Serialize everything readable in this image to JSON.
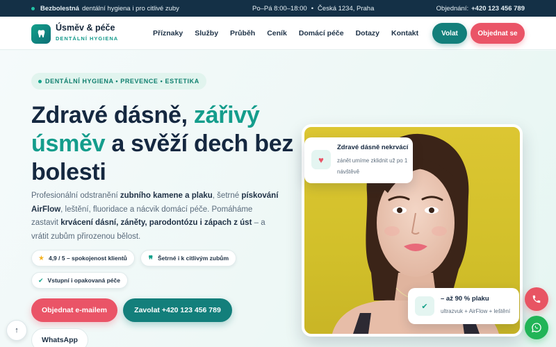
{
  "topbar": {
    "brand": "Bezbolestná",
    "brand_desc": "dentální hygiena i pro citlivé zuby",
    "hours": "Po–Pá 8:00–18:00",
    "separator": "•",
    "address": "Česká 1234, Praha",
    "phone_label": "Objednání:",
    "phone": "+420 123 456 789"
  },
  "header": {
    "logo_title": "Úsměv & péče",
    "logo_subtitle": "DENTÁLNÍ HYGIENA",
    "nav": [
      "Příznaky",
      "Služby",
      "Průběh",
      "Ceník",
      "Domácí péče",
      "Dotazy",
      "Kontakt"
    ],
    "call_label": "Volat",
    "order_label": "Objednat se"
  },
  "hero": {
    "tag": "DENTÁLNÍ HYGIENA • PREVENCE • ESTETIKA",
    "headline_1": "Zdravé dásně, ",
    "headline_accent_1": "zářivý",
    "headline_accent_2": "úsměv",
    "headline_2": " a svěží dech bez bolesti",
    "lead": {
      "p1": "Profesionální odstranění ",
      "b1": "zubního kamene a plaku",
      "p2": ", šetrné ",
      "b2": "pískování AirFlow",
      "p3": ", leštění, fluoridace a nácvik domácí péče. Pomáháme zastavit ",
      "b3": "krvácení dásní, záněty, parodontózu i zápach z úst",
      "p4": " – a vrátit zubům přirozenou bělost."
    },
    "chips": {
      "rating": "4,9 / 5 – spokojenost klientů",
      "gentle": "Šetrné i k citlivým zubům",
      "visits": "Vstupní i opakovaná péče"
    },
    "cta_email": "Objednat e-mailem",
    "cta_call": "Zavolat +420 123 456 789",
    "cta_whatsapp": "WhatsApp"
  },
  "badges": {
    "top_title": "Zdravé dásně nekrvácí",
    "top_text": "zánět umíme zklidnit už po 1 návštěvě",
    "bottom_title": "– až 90 % plaku",
    "bottom_text": "ultrazvuk + AirFlow + leštění"
  },
  "icons": {
    "scroll_top": "arrow-up-icon",
    "phone": "phone-icon",
    "whatsapp": "whatsapp-icon",
    "heart": "heart-icon",
    "check": "check-icon",
    "tooth": "tooth-icon",
    "star": "star-icon"
  },
  "colors": {
    "topbar": "#143046",
    "accent_teal": "#137f7b",
    "accent_coral": "#ea5467",
    "headline_accent": "#149d8c",
    "whatsapp": "#21b457"
  }
}
